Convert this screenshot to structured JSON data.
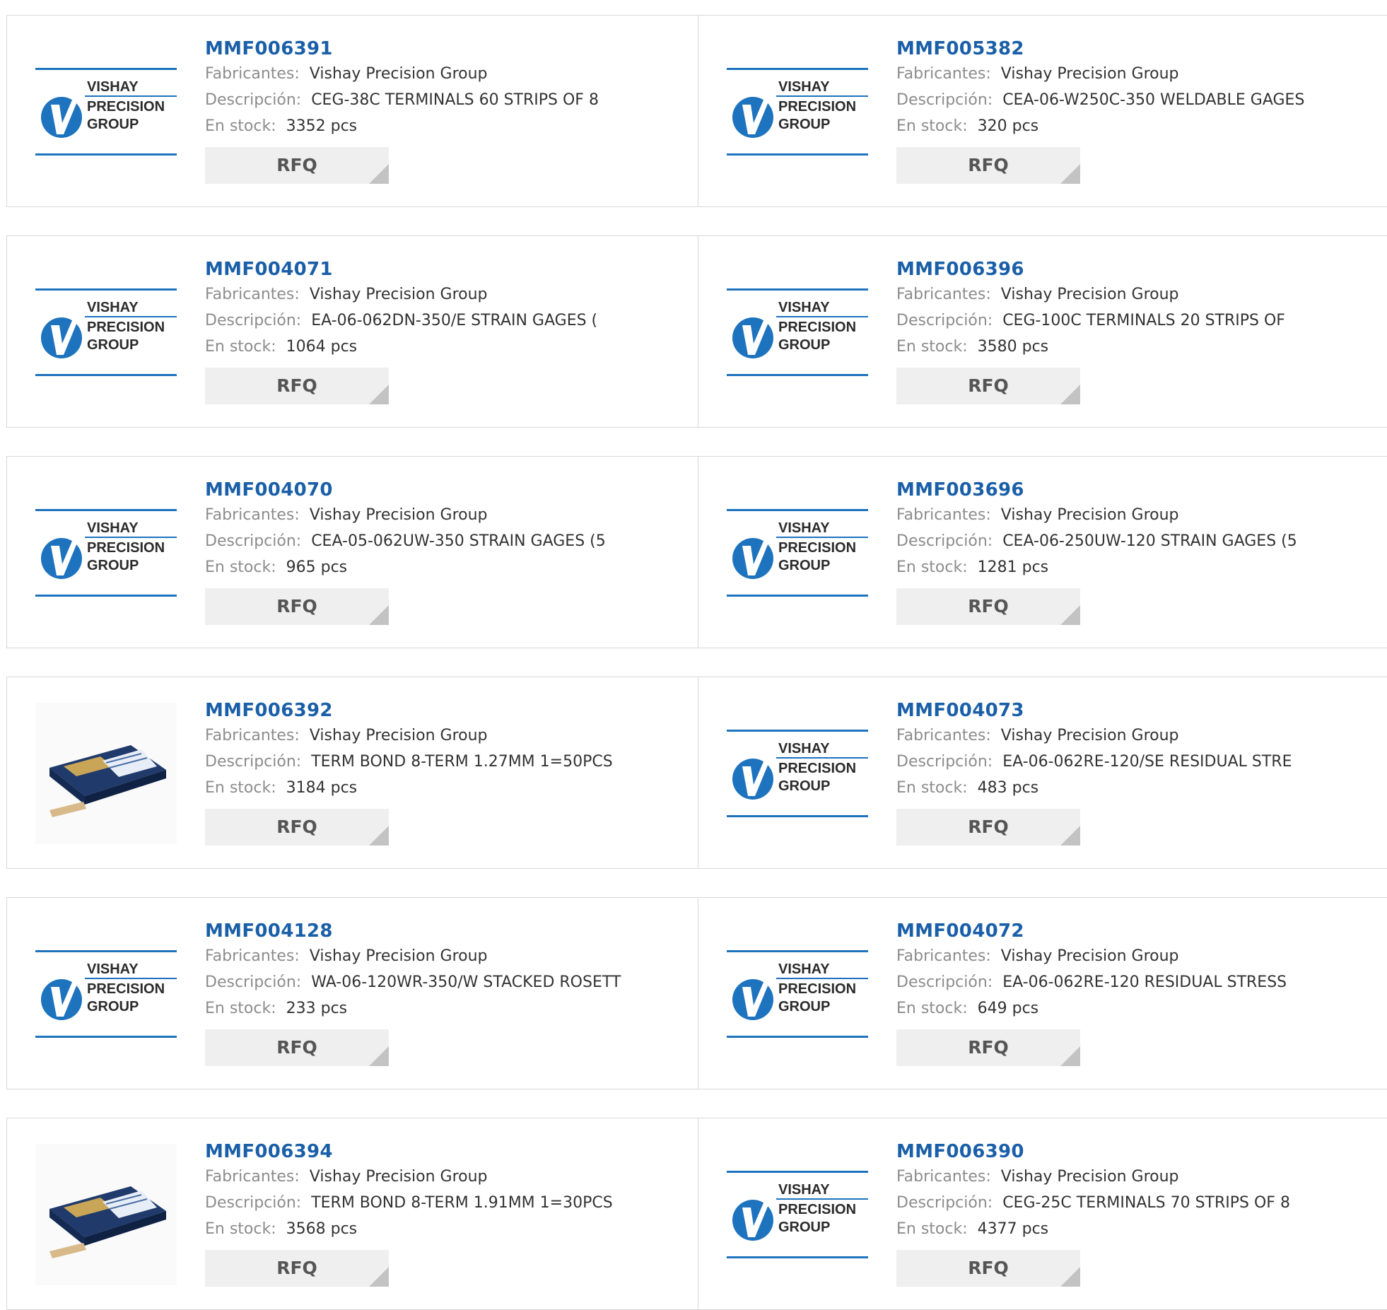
{
  "labels": {
    "manufacturer": "Fabricantes:",
    "description": "Descripción:",
    "stock": "En stock:",
    "rfq": "RFQ"
  },
  "logo_text": [
    "VISHAY",
    "PRECISION",
    "GROUP"
  ],
  "colors": {
    "part_link": "#1a5fa8",
    "logo_blue": "#1e73be",
    "rfq_bg": "#efefef"
  },
  "products": [
    {
      "part": "MMF006391",
      "manufacturer": "Vishay Precision Group",
      "description": "CEG-38C TERMINALS 60 STRIPS OF 8",
      "stock": "3352 pcs",
      "image": "vpg-logo"
    },
    {
      "part": "MMF005382",
      "manufacturer": "Vishay Precision Group",
      "description": "CEA-06-W250C-350 WELDABLE GAGES",
      "stock": "320 pcs",
      "image": "vpg-logo"
    },
    {
      "part": "MMF004071",
      "manufacturer": "Vishay Precision Group",
      "description": "EA-06-062DN-350/E STRAIN GAGES (",
      "stock": "1064 pcs",
      "image": "vpg-logo"
    },
    {
      "part": "MMF006396",
      "manufacturer": "Vishay Precision Group",
      "description": "CEG-100C TERMINALS 20 STRIPS OF",
      "stock": "3580 pcs",
      "image": "vpg-logo"
    },
    {
      "part": "MMF004070",
      "manufacturer": "Vishay Precision Group",
      "description": "CEA-05-062UW-350 STRAIN GAGES (5",
      "stock": "965 pcs",
      "image": "vpg-logo"
    },
    {
      "part": "MMF003696",
      "manufacturer": "Vishay Precision Group",
      "description": "CEA-06-250UW-120 STRAIN GAGES (5",
      "stock": "1281 pcs",
      "image": "vpg-logo"
    },
    {
      "part": "MMF006392",
      "manufacturer": "Vishay Precision Group",
      "description": "TERM BOND 8-TERM 1.27MM 1=50PCS",
      "stock": "3184 pcs",
      "image": "product-box"
    },
    {
      "part": "MMF004073",
      "manufacturer": "Vishay Precision Group",
      "description": "EA-06-062RE-120/SE RESIDUAL STRE",
      "stock": "483 pcs",
      "image": "vpg-logo"
    },
    {
      "part": "MMF004128",
      "manufacturer": "Vishay Precision Group",
      "description": "WA-06-120WR-350/W STACKED ROSETT",
      "stock": "233 pcs",
      "image": "vpg-logo"
    },
    {
      "part": "MMF004072",
      "manufacturer": "Vishay Precision Group",
      "description": "EA-06-062RE-120 RESIDUAL STRESS",
      "stock": "649 pcs",
      "image": "vpg-logo"
    },
    {
      "part": "MMF006394",
      "manufacturer": "Vishay Precision Group",
      "description": "TERM BOND 8-TERM 1.91MM 1=30PCS",
      "stock": "3568 pcs",
      "image": "product-box"
    },
    {
      "part": "MMF006390",
      "manufacturer": "Vishay Precision Group",
      "description": "CEG-25C TERMINALS 70 STRIPS OF 8",
      "stock": "4377 pcs",
      "image": "vpg-logo"
    }
  ]
}
